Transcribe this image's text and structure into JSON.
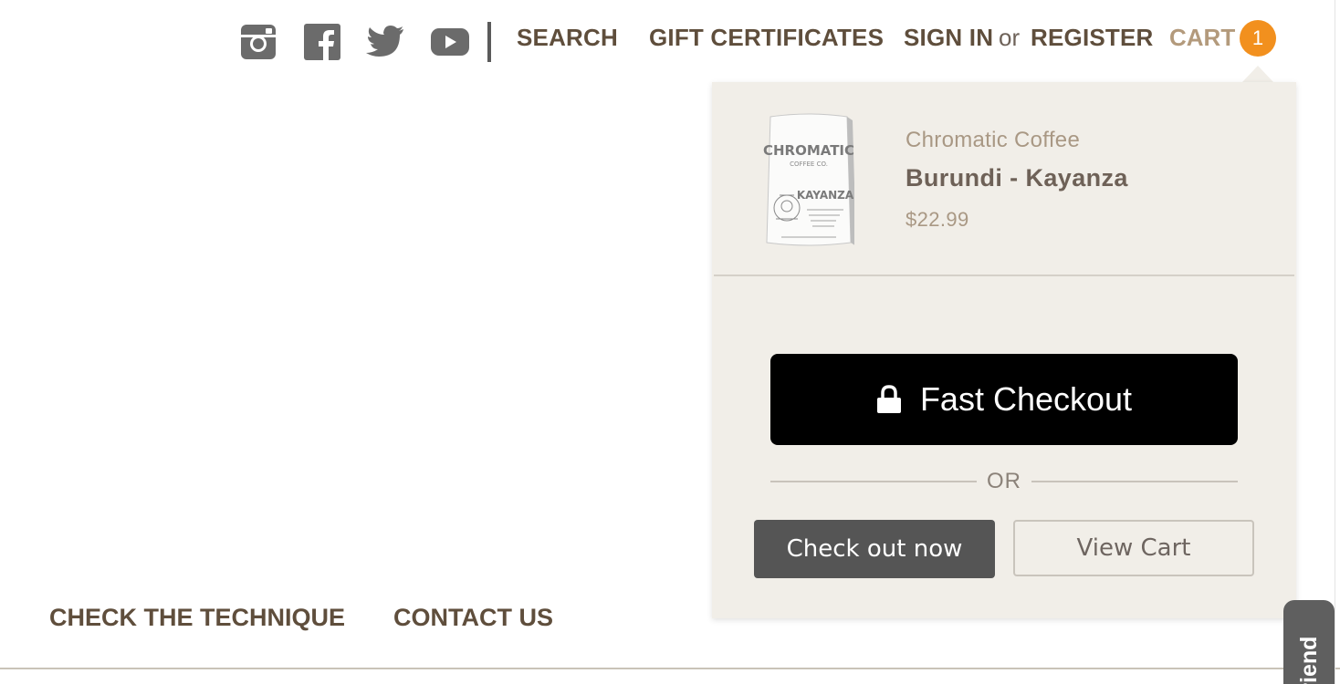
{
  "header": {
    "social": [
      {
        "icon": "instagram-icon",
        "label": "Instagram"
      },
      {
        "icon": "facebook-icon",
        "label": "Facebook"
      },
      {
        "icon": "twitter-icon",
        "label": "Twitter"
      },
      {
        "icon": "youtube-icon",
        "label": "YouTube"
      }
    ],
    "search_label": "SEARCH",
    "gift_label": "GIFT CERTIFICATES",
    "signin_label": "SIGN IN",
    "or_label": "or",
    "register_label": "REGISTER",
    "cart_label": "CART",
    "cart_count": "1"
  },
  "cart_preview": {
    "item": {
      "vendor": "Chromatic Coffee",
      "name": "Burundi - Kayanza",
      "price": "$22.99",
      "image_text": [
        "CHROMATIC",
        "COFFEE CO.",
        "KAYANZA"
      ]
    },
    "fast_checkout_label": "Fast Checkout",
    "or_label": "OR",
    "checkout_now_label": "Check out now",
    "view_cart_label": "View Cart"
  },
  "footer": {
    "links": [
      "CHECK THE TECHNIQUE",
      "CONTACT US"
    ]
  },
  "refer_tab": {
    "label": "Friend"
  },
  "colors": {
    "nav_text": "#5f4e3c",
    "cart_text": "#b39a7c",
    "badge": "#f2901e",
    "dropdown_bg": "#f1eee8",
    "fast_checkout_bg": "#000000",
    "checkout_now_bg": "#555555"
  }
}
